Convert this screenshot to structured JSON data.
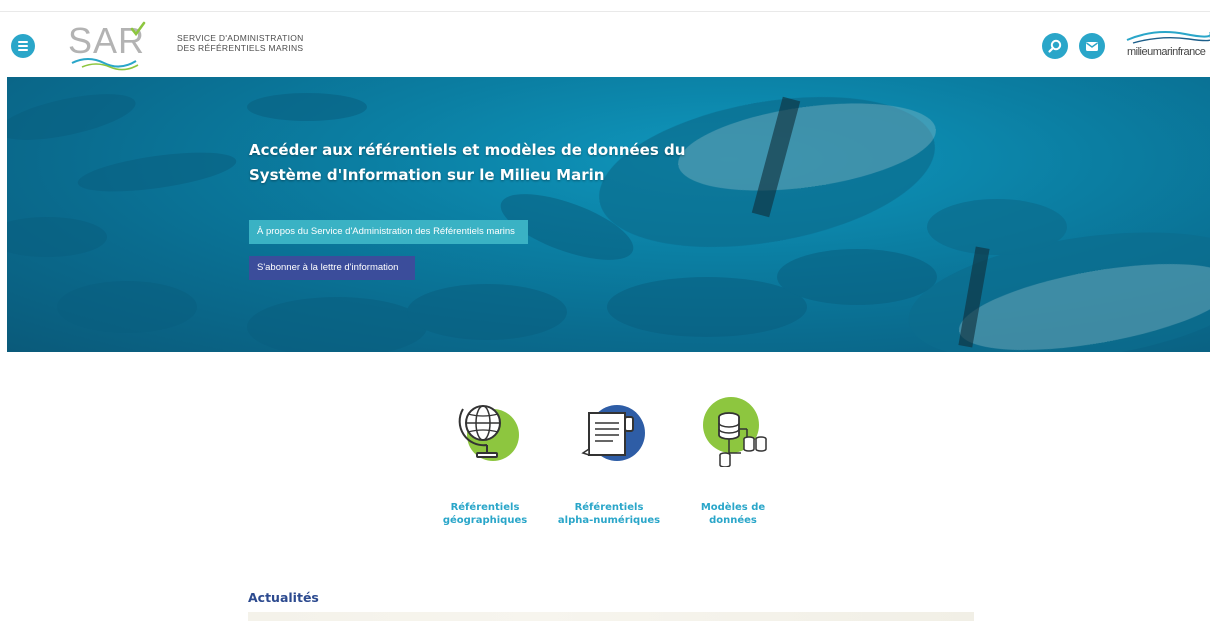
{
  "header": {
    "logo_text": "SAR",
    "logo_subtitle_line1": "SERVICE D'ADMINISTRATION",
    "logo_subtitle_line2": "DES RÉFÉRENTIELS MARINS",
    "partner_logo_text": "milieumarinfrance"
  },
  "hero": {
    "title": "Accéder aux référentiels et modèles de données du Système d'Information sur le Milieu Marin",
    "about_button": "À propos du Service d'Administration des Référentiels marins",
    "subscribe_button": "S'abonner à la lettre d'information"
  },
  "categories": [
    {
      "line1": "Référentiels",
      "line2": "géographiques",
      "icon": "globe-icon"
    },
    {
      "line1": "Référentiels",
      "line2": "alpha-numériques",
      "icon": "document-icon"
    },
    {
      "line1": "Modèles de",
      "line2": "données",
      "icon": "database-icon"
    }
  ],
  "news": {
    "heading": "Actualités"
  },
  "colors": {
    "accent": "#2aa6c9",
    "green": "#8dc63f",
    "navy": "#2c4a8f",
    "hero_button": "#3ab2c4",
    "subscribe_button": "#3b4d9b"
  }
}
